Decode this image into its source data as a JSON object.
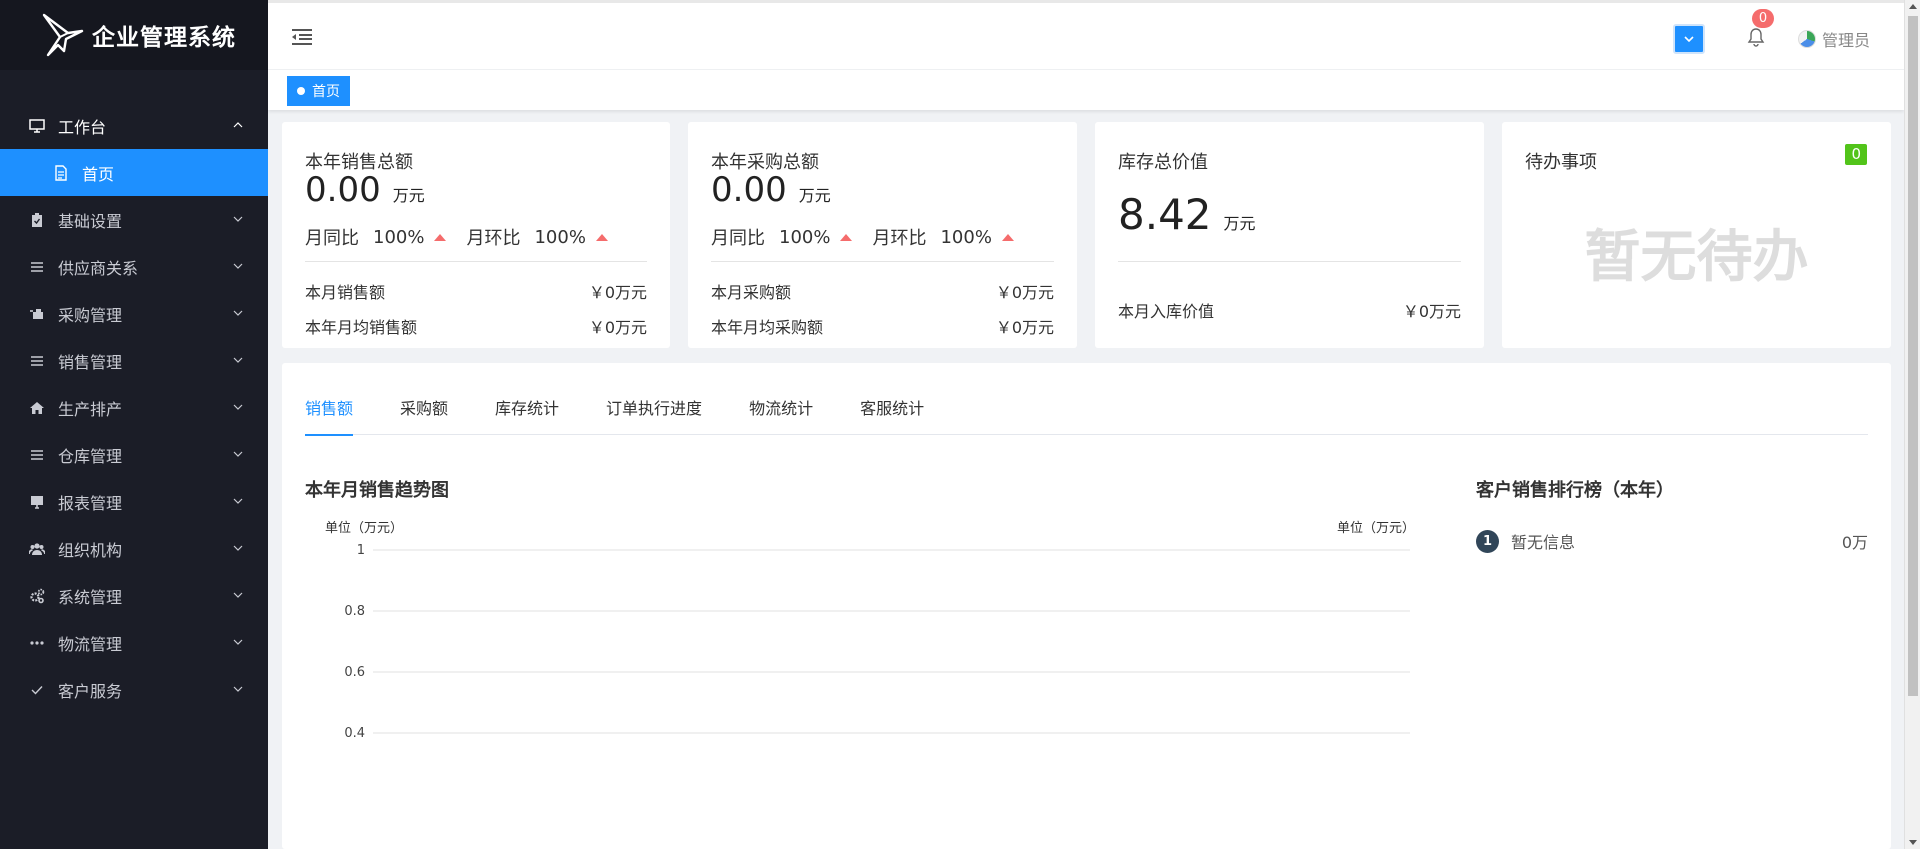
{
  "app": {
    "title": "企业管理系统"
  },
  "sidebar": {
    "items": [
      {
        "label": "工作台",
        "icon": "monitor-icon",
        "state": "open"
      },
      {
        "label": "首页",
        "icon": "document-icon",
        "state": "active"
      },
      {
        "label": "基础设置",
        "icon": "clipboard-icon",
        "state": "collapsed"
      },
      {
        "label": "供应商关系",
        "icon": "list-icon",
        "state": "collapsed"
      },
      {
        "label": "采购管理",
        "icon": "cart-icon",
        "state": "collapsed"
      },
      {
        "label": "销售管理",
        "icon": "list-icon",
        "state": "collapsed"
      },
      {
        "label": "生产排产",
        "icon": "home-icon",
        "state": "collapsed"
      },
      {
        "label": "仓库管理",
        "icon": "list-icon",
        "state": "collapsed"
      },
      {
        "label": "报表管理",
        "icon": "screen-icon",
        "state": "collapsed"
      },
      {
        "label": "组织机构",
        "icon": "users-icon",
        "state": "collapsed"
      },
      {
        "label": "系统管理",
        "icon": "gears-icon",
        "state": "collapsed"
      },
      {
        "label": "物流管理",
        "icon": "dots-icon",
        "state": "collapsed"
      },
      {
        "label": "客户服务",
        "icon": "check-icon",
        "state": "collapsed"
      }
    ]
  },
  "header": {
    "notification_count": "0",
    "user_name": "管理员"
  },
  "breadcrumb": {
    "home": "首页"
  },
  "cards": {
    "sales": {
      "title": "本年销售总额",
      "value": "0.00",
      "unit": "万元",
      "yoy_label": "月同比",
      "yoy_value": "100%",
      "mom_label": "月环比",
      "mom_value": "100%",
      "row1_label": "本月销售额",
      "row1_value": "￥0万元",
      "row2_label": "本年月均销售额",
      "row2_value": "￥0万元"
    },
    "purchase": {
      "title": "本年采购总额",
      "value": "0.00",
      "unit": "万元",
      "yoy_label": "月同比",
      "yoy_value": "100%",
      "mom_label": "月环比",
      "mom_value": "100%",
      "row1_label": "本月采购额",
      "row1_value": "￥0万元",
      "row2_label": "本年月均采购额",
      "row2_value": "￥0万元"
    },
    "inventory": {
      "title": "库存总价值",
      "value": "8.42",
      "unit": "万元",
      "row1_label": "本月入库价值",
      "row1_value": "￥0万元"
    },
    "todo": {
      "title": "待办事项",
      "count": "0",
      "empty_text": "暂无待办"
    }
  },
  "tabs": [
    "销售额",
    "采购额",
    "库存统计",
    "订单执行进度",
    "物流统计",
    "客服统计"
  ],
  "active_tab": 0,
  "chart": {
    "title": "本年月销售趋势图",
    "left_unit": "单位（万元）",
    "right_unit": "单位（万元）"
  },
  "chart_data": {
    "type": "line",
    "title": "本年月销售趋势图",
    "ylabel": "单位（万元）",
    "y2label": "单位（万元）",
    "y_ticks": [
      1,
      0.8,
      0.6,
      0.4
    ],
    "ylim": [
      0,
      1
    ],
    "grid": true,
    "series": []
  },
  "ranking": {
    "title": "客户销售排行榜（本年）",
    "items": [
      {
        "rank": "1",
        "name": "暂无信息",
        "value": "0万"
      }
    ]
  },
  "colors": {
    "sidebar_bg": "#1b1d27",
    "accent": "#1e90ff",
    "up_arrow": "#f56c6c",
    "badge_green": "#52c41a"
  }
}
